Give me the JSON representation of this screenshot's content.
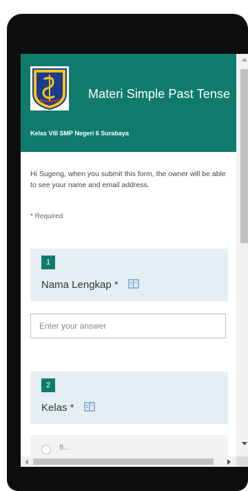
{
  "form": {
    "title": "Materi Simple Past Tense",
    "subtitle": "Kelas VIII SMP Negeri 6 Surabaya",
    "info_text": "Hi Sugeng, when you submit this form, the owner will be able to see your name and email address.",
    "required_star": "*",
    "required_label": "Required",
    "questions": [
      {
        "number": "1",
        "label": "Nama Lengkap",
        "required_mark": "*",
        "answer_placeholder": "Enter your answer"
      },
      {
        "number": "2",
        "label": "Kelas",
        "required_mark": "*",
        "first_option": "8..."
      }
    ]
  },
  "colors": {
    "header_bg": "#0f7b6c",
    "card_bg": "#e5eff3",
    "accent": "#0f7b6c"
  },
  "icons": {
    "logo": "surabaya-crest-icon",
    "immersive_reader": "immersive-reader-icon"
  }
}
